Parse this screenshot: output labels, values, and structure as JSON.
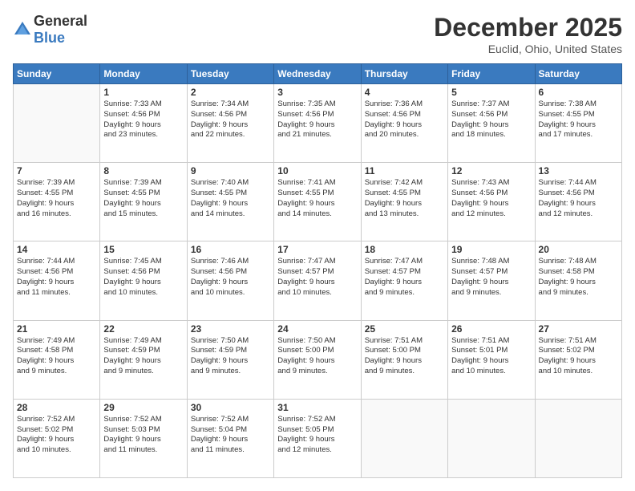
{
  "logo": {
    "general": "General",
    "blue": "Blue"
  },
  "header": {
    "month": "December 2025",
    "location": "Euclid, Ohio, United States"
  },
  "days_of_week": [
    "Sunday",
    "Monday",
    "Tuesday",
    "Wednesday",
    "Thursday",
    "Friday",
    "Saturday"
  ],
  "weeks": [
    [
      {
        "day": "",
        "info": ""
      },
      {
        "day": "1",
        "info": "Sunrise: 7:33 AM\nSunset: 4:56 PM\nDaylight: 9 hours\nand 23 minutes."
      },
      {
        "day": "2",
        "info": "Sunrise: 7:34 AM\nSunset: 4:56 PM\nDaylight: 9 hours\nand 22 minutes."
      },
      {
        "day": "3",
        "info": "Sunrise: 7:35 AM\nSunset: 4:56 PM\nDaylight: 9 hours\nand 21 minutes."
      },
      {
        "day": "4",
        "info": "Sunrise: 7:36 AM\nSunset: 4:56 PM\nDaylight: 9 hours\nand 20 minutes."
      },
      {
        "day": "5",
        "info": "Sunrise: 7:37 AM\nSunset: 4:56 PM\nDaylight: 9 hours\nand 18 minutes."
      },
      {
        "day": "6",
        "info": "Sunrise: 7:38 AM\nSunset: 4:55 PM\nDaylight: 9 hours\nand 17 minutes."
      }
    ],
    [
      {
        "day": "7",
        "info": "Sunrise: 7:39 AM\nSunset: 4:55 PM\nDaylight: 9 hours\nand 16 minutes."
      },
      {
        "day": "8",
        "info": "Sunrise: 7:39 AM\nSunset: 4:55 PM\nDaylight: 9 hours\nand 15 minutes."
      },
      {
        "day": "9",
        "info": "Sunrise: 7:40 AM\nSunset: 4:55 PM\nDaylight: 9 hours\nand 14 minutes."
      },
      {
        "day": "10",
        "info": "Sunrise: 7:41 AM\nSunset: 4:55 PM\nDaylight: 9 hours\nand 14 minutes."
      },
      {
        "day": "11",
        "info": "Sunrise: 7:42 AM\nSunset: 4:55 PM\nDaylight: 9 hours\nand 13 minutes."
      },
      {
        "day": "12",
        "info": "Sunrise: 7:43 AM\nSunset: 4:56 PM\nDaylight: 9 hours\nand 12 minutes."
      },
      {
        "day": "13",
        "info": "Sunrise: 7:44 AM\nSunset: 4:56 PM\nDaylight: 9 hours\nand 12 minutes."
      }
    ],
    [
      {
        "day": "14",
        "info": "Sunrise: 7:44 AM\nSunset: 4:56 PM\nDaylight: 9 hours\nand 11 minutes."
      },
      {
        "day": "15",
        "info": "Sunrise: 7:45 AM\nSunset: 4:56 PM\nDaylight: 9 hours\nand 10 minutes."
      },
      {
        "day": "16",
        "info": "Sunrise: 7:46 AM\nSunset: 4:56 PM\nDaylight: 9 hours\nand 10 minutes."
      },
      {
        "day": "17",
        "info": "Sunrise: 7:47 AM\nSunset: 4:57 PM\nDaylight: 9 hours\nand 10 minutes."
      },
      {
        "day": "18",
        "info": "Sunrise: 7:47 AM\nSunset: 4:57 PM\nDaylight: 9 hours\nand 9 minutes."
      },
      {
        "day": "19",
        "info": "Sunrise: 7:48 AM\nSunset: 4:57 PM\nDaylight: 9 hours\nand 9 minutes."
      },
      {
        "day": "20",
        "info": "Sunrise: 7:48 AM\nSunset: 4:58 PM\nDaylight: 9 hours\nand 9 minutes."
      }
    ],
    [
      {
        "day": "21",
        "info": "Sunrise: 7:49 AM\nSunset: 4:58 PM\nDaylight: 9 hours\nand 9 minutes."
      },
      {
        "day": "22",
        "info": "Sunrise: 7:49 AM\nSunset: 4:59 PM\nDaylight: 9 hours\nand 9 minutes."
      },
      {
        "day": "23",
        "info": "Sunrise: 7:50 AM\nSunset: 4:59 PM\nDaylight: 9 hours\nand 9 minutes."
      },
      {
        "day": "24",
        "info": "Sunrise: 7:50 AM\nSunset: 5:00 PM\nDaylight: 9 hours\nand 9 minutes."
      },
      {
        "day": "25",
        "info": "Sunrise: 7:51 AM\nSunset: 5:00 PM\nDaylight: 9 hours\nand 9 minutes."
      },
      {
        "day": "26",
        "info": "Sunrise: 7:51 AM\nSunset: 5:01 PM\nDaylight: 9 hours\nand 10 minutes."
      },
      {
        "day": "27",
        "info": "Sunrise: 7:51 AM\nSunset: 5:02 PM\nDaylight: 9 hours\nand 10 minutes."
      }
    ],
    [
      {
        "day": "28",
        "info": "Sunrise: 7:52 AM\nSunset: 5:02 PM\nDaylight: 9 hours\nand 10 minutes."
      },
      {
        "day": "29",
        "info": "Sunrise: 7:52 AM\nSunset: 5:03 PM\nDaylight: 9 hours\nand 11 minutes."
      },
      {
        "day": "30",
        "info": "Sunrise: 7:52 AM\nSunset: 5:04 PM\nDaylight: 9 hours\nand 11 minutes."
      },
      {
        "day": "31",
        "info": "Sunrise: 7:52 AM\nSunset: 5:05 PM\nDaylight: 9 hours\nand 12 minutes."
      },
      {
        "day": "",
        "info": ""
      },
      {
        "day": "",
        "info": ""
      },
      {
        "day": "",
        "info": ""
      }
    ]
  ]
}
